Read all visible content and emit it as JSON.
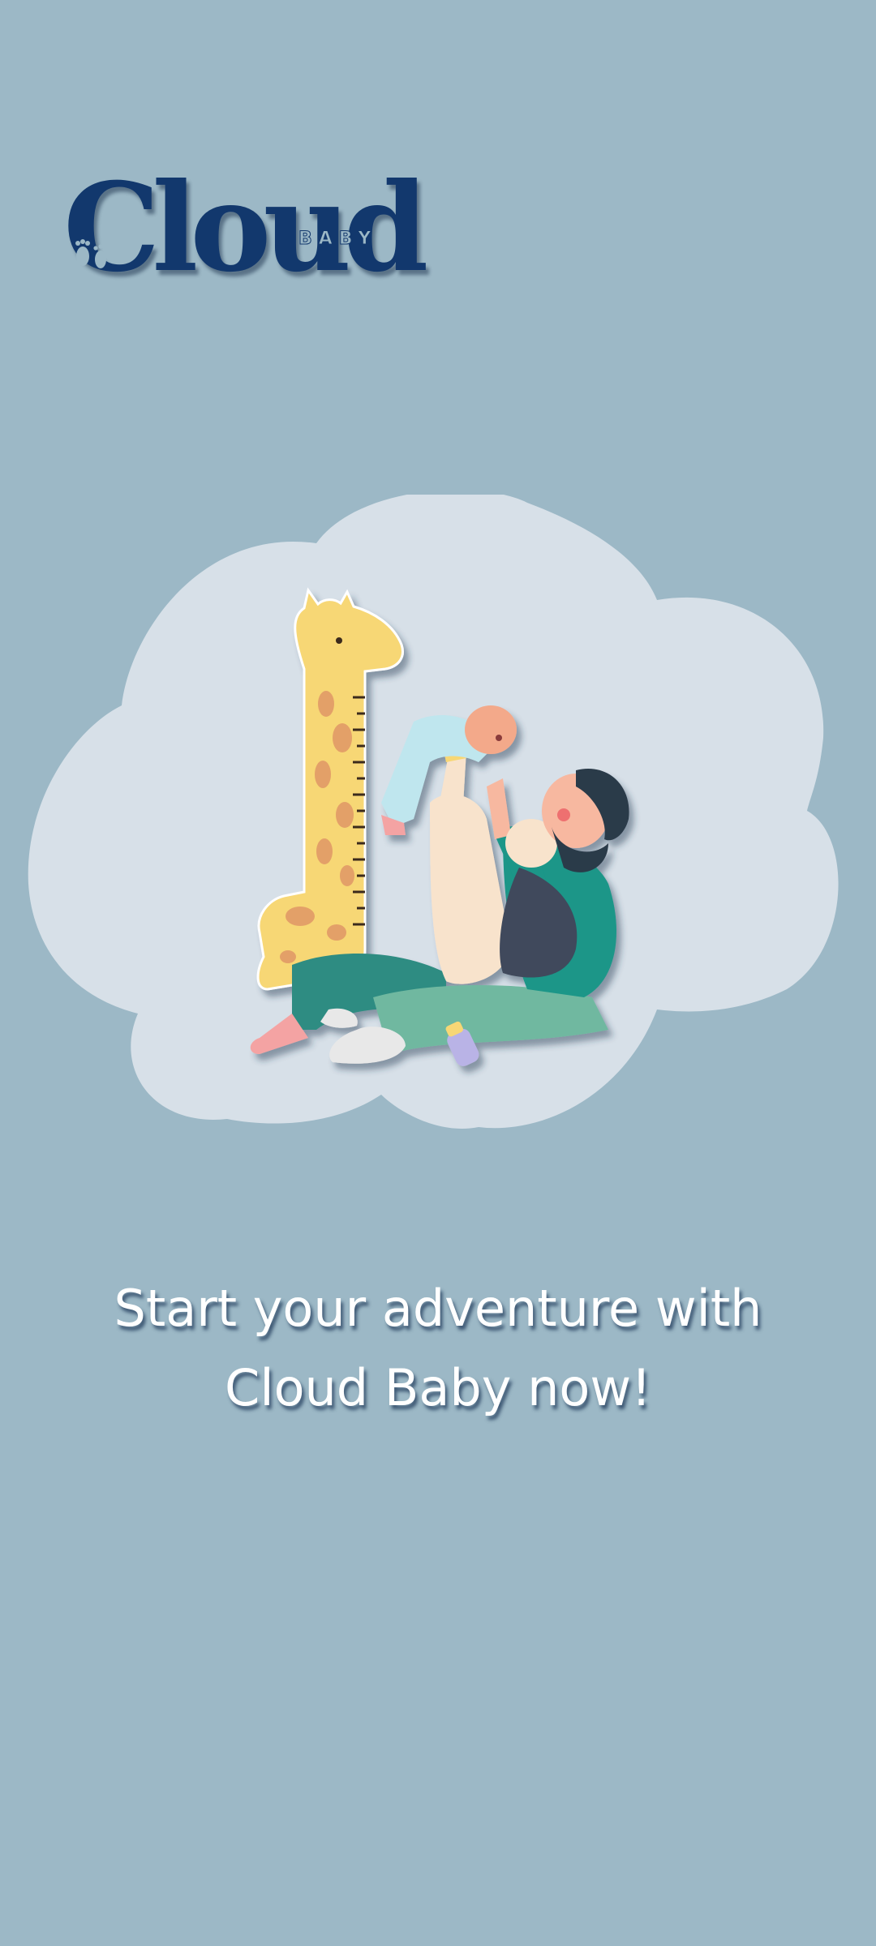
{
  "app": {
    "logo": {
      "word": "Cloud",
      "sub": "BABY",
      "icon": "footprints-icon"
    }
  },
  "hero": {
    "illustration": "giraffe-height-chart-family-illustration"
  },
  "tagline": {
    "line1": "Start your adventure with",
    "line2": "Cloud Baby now!"
  },
  "colors": {
    "background": "#9cb8c6",
    "cloud": "#d7e0e8",
    "brand_navy": "#12386d",
    "text": "#ffffff"
  }
}
